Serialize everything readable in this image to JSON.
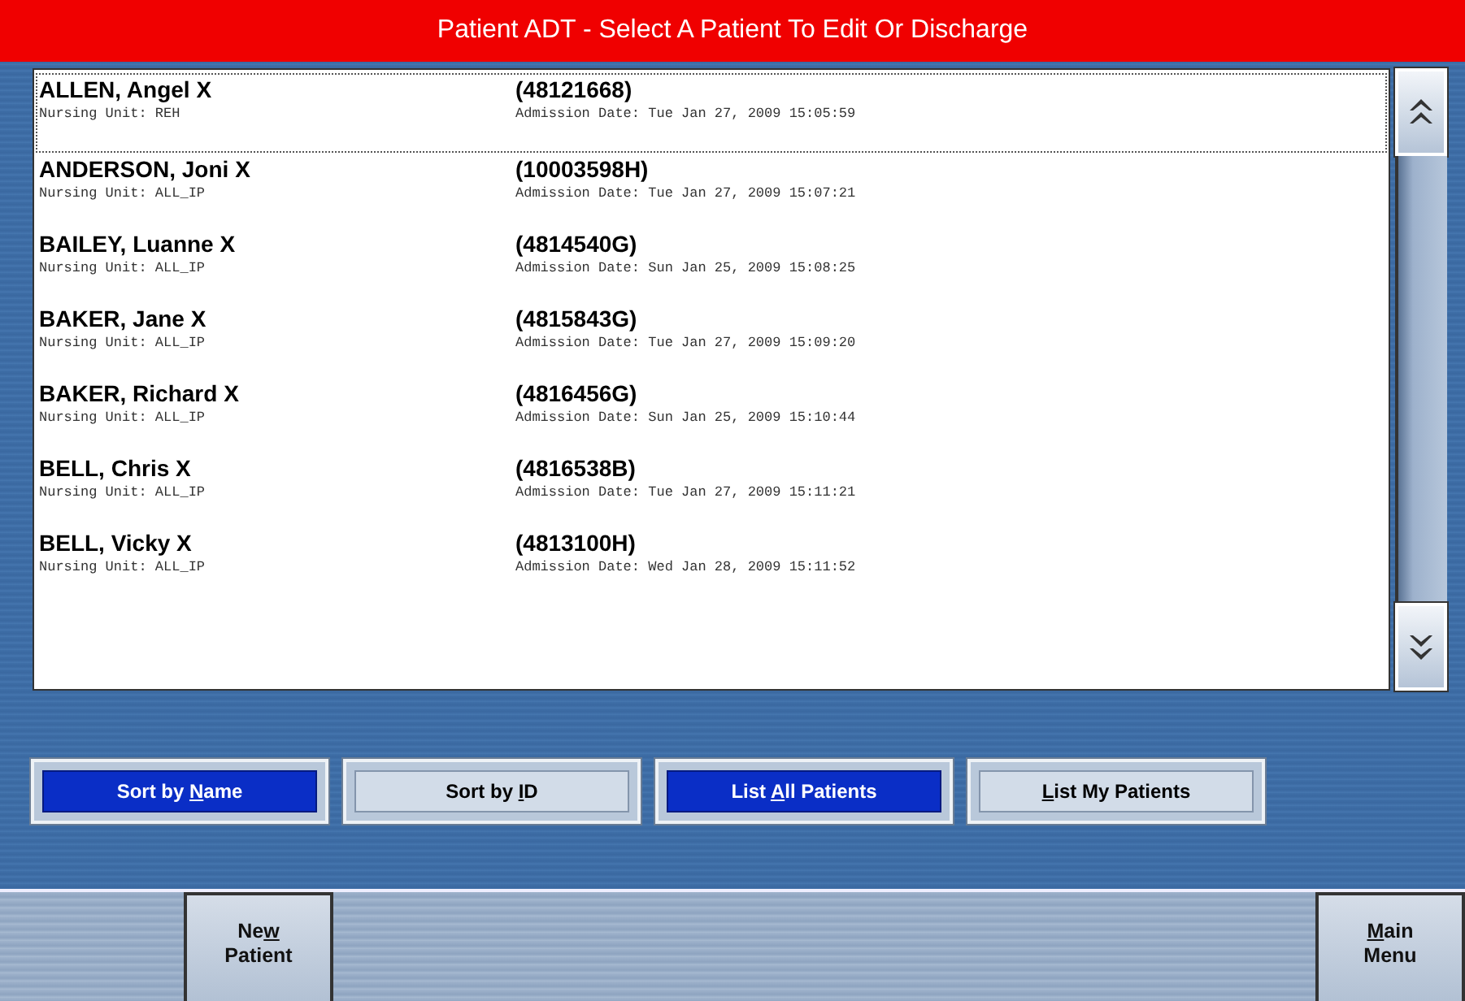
{
  "window": {
    "title": "Patient ADT - Select A Patient To Edit Or Discharge"
  },
  "patients": [
    {
      "name": "ALLEN, Angel X",
      "id": "(48121668)",
      "unit": "Nursing Unit: REH",
      "admission": "Admission Date: Tue Jan 27, 2009 15:05:59",
      "selected": true
    },
    {
      "name": "ANDERSON, Joni X",
      "id": "(10003598H)",
      "unit": "Nursing Unit: ALL_IP",
      "admission": "Admission Date: Tue Jan 27, 2009 15:07:21",
      "selected": false
    },
    {
      "name": "BAILEY, Luanne X",
      "id": "(4814540G)",
      "unit": "Nursing Unit: ALL_IP",
      "admission": "Admission Date: Sun Jan 25, 2009 15:08:25",
      "selected": false
    },
    {
      "name": "BAKER, Jane X",
      "id": "(4815843G)",
      "unit": "Nursing Unit: ALL_IP",
      "admission": "Admission Date: Tue Jan 27, 2009 15:09:20",
      "selected": false
    },
    {
      "name": "BAKER, Richard X",
      "id": "(4816456G)",
      "unit": "Nursing Unit: ALL_IP",
      "admission": "Admission Date: Sun Jan 25, 2009 15:10:44",
      "selected": false
    },
    {
      "name": "BELL, Chris X",
      "id": "(4816538B)",
      "unit": "Nursing Unit: ALL_IP",
      "admission": "Admission Date: Tue Jan 27, 2009 15:11:21",
      "selected": false
    },
    {
      "name": "BELL, Vicky X",
      "id": "(4813100H)",
      "unit": "Nursing Unit: ALL_IP",
      "admission": "Admission Date: Wed Jan 28, 2009 15:11:52",
      "selected": false
    }
  ],
  "filter_buttons": [
    {
      "before": "Sort by ",
      "key": "N",
      "after": "ame",
      "selected": true
    },
    {
      "before": "Sort by ",
      "key": "I",
      "after": "D",
      "selected": false
    },
    {
      "before": "List ",
      "key": "A",
      "after": "ll Patients",
      "selected": true
    },
    {
      "key": "L",
      "after": "ist My Patients",
      "selected": false
    }
  ],
  "bottom_buttons": [
    {
      "lines": [
        {
          "before": "Ne",
          "key": "w"
        },
        {
          "before": "Patient"
        }
      ]
    },
    {
      "lines": [
        {
          "key": "M",
          "after": "ain"
        },
        {
          "before": "Menu"
        }
      ]
    }
  ]
}
